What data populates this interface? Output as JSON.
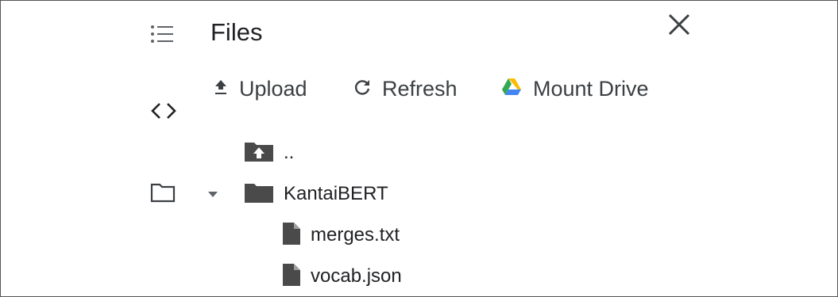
{
  "panel": {
    "title": "Files"
  },
  "toolbar": {
    "upload_label": "Upload",
    "refresh_label": "Refresh",
    "mount_drive_label": "Mount Drive"
  },
  "tree": {
    "parent_label": "..",
    "folder_label": "KantaiBERT",
    "files": [
      "merges.txt",
      "vocab.json"
    ]
  },
  "icons": {
    "toc": "table-of-contents-icon",
    "code": "code-snippets-icon",
    "files_rail": "folder-outline-icon",
    "close": "close-icon",
    "upload": "upload-icon",
    "refresh": "refresh-icon",
    "drive": "google-drive-icon",
    "parent": "folder-up-icon",
    "folder": "folder-icon",
    "file": "file-icon",
    "caret": "caret-down-icon"
  },
  "colors": {
    "text": "#202124",
    "icon": "#5f6368",
    "drive_yellow": "#FBBC04",
    "drive_green": "#34A853",
    "drive_blue": "#4285F4"
  }
}
